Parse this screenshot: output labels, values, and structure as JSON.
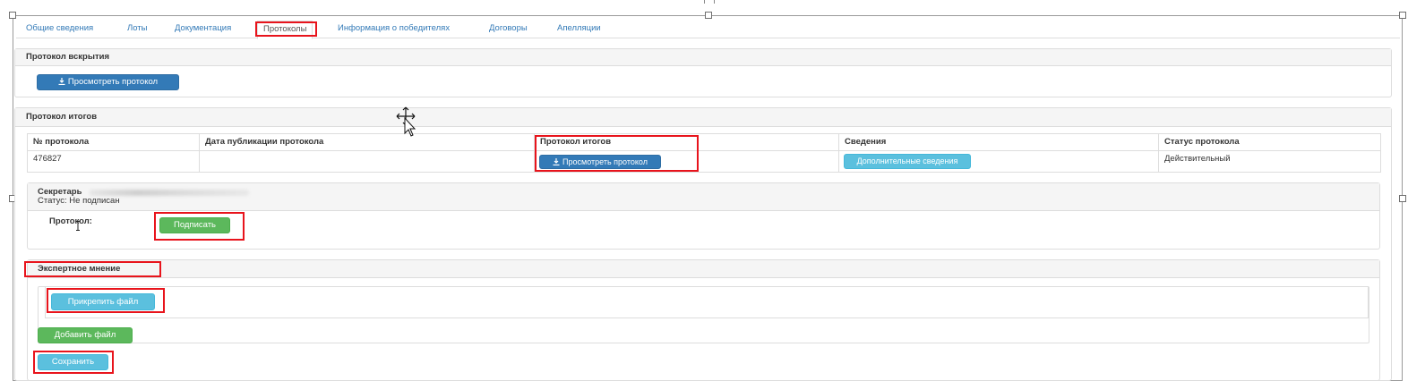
{
  "tabs": [
    {
      "label": "Общие сведения"
    },
    {
      "label": "Лоты"
    },
    {
      "label": "Документация"
    },
    {
      "label": "Протоколы"
    },
    {
      "label": "Информация о победителях"
    },
    {
      "label": "Договоры"
    },
    {
      "label": "Апелляции"
    }
  ],
  "opening": {
    "title": "Протокол вскрытия",
    "view_button": "Просмотреть протокол"
  },
  "results": {
    "title": "Протокол итогов",
    "columns": [
      "№ протокола",
      "Дата публикации протокола",
      "Протокол итогов",
      "Сведения",
      "Статус протокола"
    ],
    "row": {
      "number": "476827",
      "date": "",
      "view_button": "Просмотреть протокол",
      "details_button": "Дополнительные сведения",
      "status": "Действительный"
    }
  },
  "secretary": {
    "label": "Секретарь",
    "status": "Статус: Не подписан",
    "protocol_label": "Протокол:",
    "sign_button": "Подписать"
  },
  "expert": {
    "title": "Экспертное мнение",
    "attach_button": "Прикрепить файл",
    "add_button": "Добавить файл",
    "save_button": "Сохранить"
  },
  "colors": {
    "primary": "#337ab7",
    "info": "#5bc0de",
    "success": "#5cb85c",
    "highlight": "#e8141c",
    "link": "#337ab7"
  }
}
